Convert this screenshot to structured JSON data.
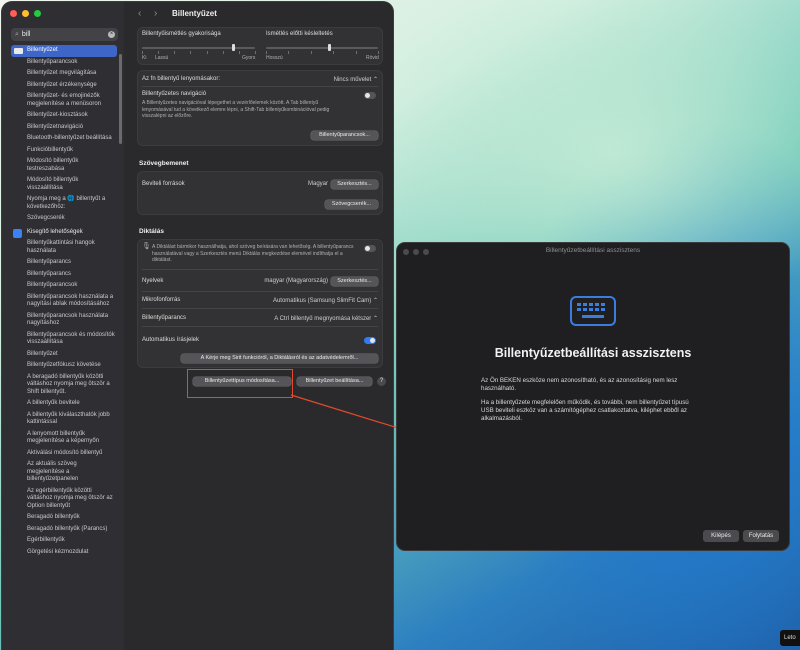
{
  "sidebar": {
    "search_value": "bill",
    "items": [
      {
        "label": "Billentyűzet",
        "selected": true
      },
      {
        "label": "Billentyűparancsok"
      },
      {
        "label": "Billentyűzet megvilágítása"
      },
      {
        "label": "Billentyűzet érzékenysége"
      },
      {
        "label": "Billentyűzet- és emojinézők megjelenítése a menüsoron"
      },
      {
        "label": "Billentyűzet-kiosztások"
      },
      {
        "label": "Billentyűzetnavigáció"
      },
      {
        "label": "Bluetooth-billentyűzet beállítása"
      },
      {
        "label": "Funkcióbillentyűk"
      },
      {
        "label": "Módosító billentyűk testreszabása"
      },
      {
        "label": "Módosító billentyűk visszaállítása"
      },
      {
        "label": "Nyomja meg a 🌐 billentyűt a következőhöz:"
      },
      {
        "label": "Szövegcserék"
      },
      {
        "label": "Kisegítő lehetőségek",
        "header": true
      },
      {
        "label": "Billentyűkattintási hangok használata"
      },
      {
        "label": "Billentyűparancs"
      },
      {
        "label": "Billentyűparancs"
      },
      {
        "label": "Billentyűparancsok"
      },
      {
        "label": "Billentyűparancsok használata a nagyítási ablak módosításához"
      },
      {
        "label": "Billentyűparancsok használata nagyításhoz"
      },
      {
        "label": "Billentyűparancsok és módosítók visszaállítása"
      },
      {
        "label": "Billentyűzet"
      },
      {
        "label": "Billentyűzetfókusz követése"
      },
      {
        "label": "A beragadó billentyűk közötti váltáshoz nyomja meg ötször a Shift billentyűt."
      },
      {
        "label": "A billentyűk bevitele"
      },
      {
        "label": "A billentyűk kiválaszthatók jobb kattintással"
      },
      {
        "label": "A lenyomott billentyűk megjelenítése a képernyőn"
      },
      {
        "label": "Aktiválási módosító billentyű"
      },
      {
        "label": "Az aktuális szöveg megjelenítése a billentyűzetpanelen"
      },
      {
        "label": "Az egérbillentyűk közötti váltáshoz nyomja meg ötször az Option billentyűt"
      },
      {
        "label": "Beragadó billentyűk"
      },
      {
        "label": "Beragadó billentyűk (Parancs)"
      },
      {
        "label": "Egérbillentyűk"
      },
      {
        "label": "Görgetési kézmozdulat"
      }
    ]
  },
  "content": {
    "title": "Billentyűzet",
    "repeat_rate": {
      "label": "Billentyűismétlés gyakorisága",
      "min": "Ki",
      "low": "Lassú",
      "high": "Gyors",
      "level": 0.8
    },
    "repeat_delay": {
      "label": "Ismétlés előtti késleltetés",
      "low": "Hosszú",
      "high": "Rövid",
      "level": 0.55
    },
    "fn_key": {
      "label": "Az fn billentyű lenyomásakor:",
      "value": "Nincs művelet"
    },
    "keyboard_nav": {
      "label": "Billentyűzetes navigáció",
      "description": "A Billentyűzetes navigációval lépegethet a vezérlőelemek között. A Tab billentyű lenyomásával tud a következő elemre lépni, a Shift-Tab billentyűkombinációval pedig visszalépni az előzőre.",
      "enabled": false
    },
    "shortcuts_button": "Billentyűparancsok...",
    "text_input": {
      "title": "Szövegbemenet",
      "sources_label": "Beviteli források",
      "sources_value": "Magyar",
      "edit_button": "Szerkesztés...",
      "replacements_button": "Szövegcserék..."
    },
    "dictation": {
      "title": "Diktálás",
      "description": "A Diktálást bármikor használhatja, ahol szöveg beírására van lehetőség. A billentyűparancs használatával vagy a Szerkesztés menü Diktálás megkezdése elemével indíthatja el a diktálást.",
      "enabled": false,
      "languages_label": "Nyelvek",
      "languages_value": "magyar (Magyarország)",
      "languages_button": "Szerkesztés...",
      "mic_label": "Mikrofonforrás",
      "mic_value": "Automatikus (Samsung SlimFit Cam)",
      "shortcut_label": "Billentyűparancs",
      "shortcut_value": "A Ctrl billentyű megnyomása kétszer",
      "punctuation_label": "Automatikus írásjelek",
      "punctuation_enabled": true,
      "siri_button": "A Kérje meg Sirit funkcióról, a Diktálásról és az adatvédelemről..."
    },
    "change_type_button": "Billentyűzettípus módosítása...",
    "keyboard_setup_button": "Billentyűzet beállítása...",
    "help": "?"
  },
  "assistant": {
    "window_title": "Billentyűzetbeállítási asszisztens",
    "heading": "Billentyűzetbeállítási asszisztens",
    "para1": "Az Ön BEKEN eszköze nem azonosítható, és az azonosításig nem lesz használható.",
    "para2": "Ha a billentyűzete megfelelően működik, és további, nem billentyűzet típusú USB beviteli eszköz van a számítógéphez csatlakoztatva, kiléphet ebből az alkalmazásból.",
    "quit_button": "Kilépés",
    "continue_button": "Folytatás"
  },
  "dock_hint": "Leto",
  "colors": {
    "accent": "#2f7cf6",
    "annotation": "#e24a2d"
  }
}
